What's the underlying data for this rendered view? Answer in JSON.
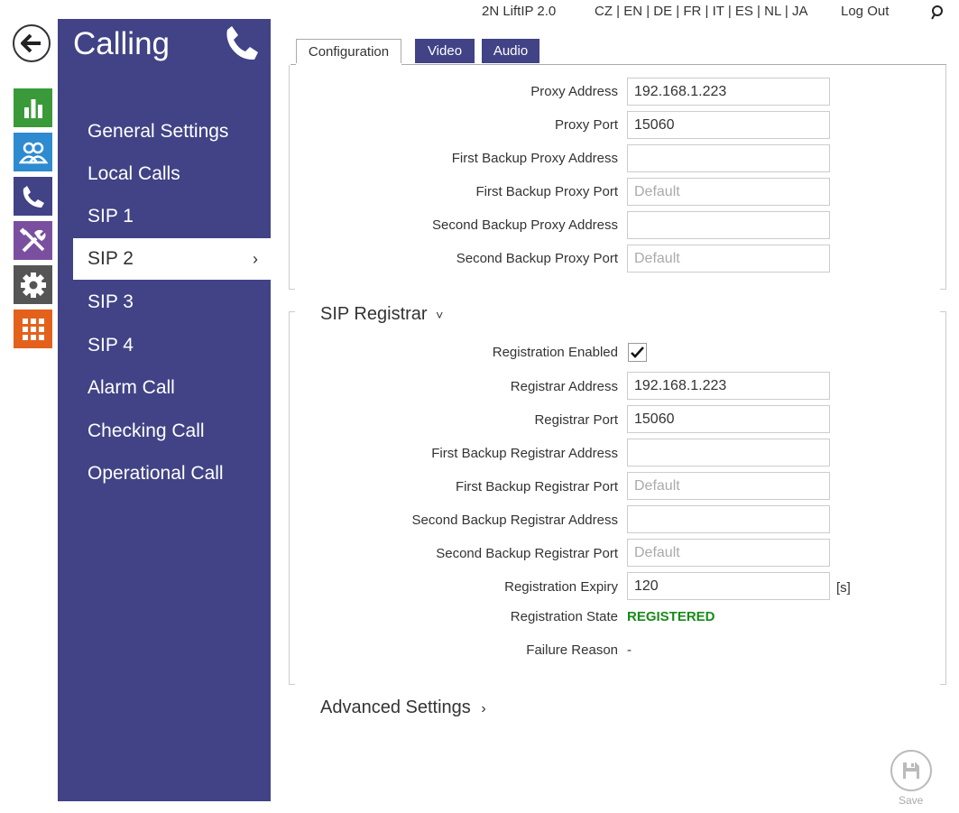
{
  "colors": {
    "sidebar": "#414386",
    "status_green": "#3a9a3a",
    "users_blue": "#2e8bd0",
    "calling_navy": "#414386",
    "services_purple": "#7b4fa0",
    "system_gray": "#555555",
    "apps_orange": "#e4611c",
    "registered_green": "#1a8a1a"
  },
  "rail": [
    {
      "name": "status-icon"
    },
    {
      "name": "directory-icon"
    },
    {
      "name": "phone-icon"
    },
    {
      "name": "tools-icon"
    },
    {
      "name": "gear-icon"
    },
    {
      "name": "grid-icon"
    }
  ],
  "sidebar": {
    "title": "Calling",
    "items": [
      {
        "label": "General Settings"
      },
      {
        "label": "Local Calls"
      },
      {
        "label": "SIP 1"
      },
      {
        "label": "SIP 2",
        "active": true
      },
      {
        "label": "SIP 3"
      },
      {
        "label": "SIP 4"
      },
      {
        "label": "Alarm Call"
      },
      {
        "label": "Checking Call"
      },
      {
        "label": "Operational Call"
      }
    ]
  },
  "topbar": {
    "product": "2N LiftIP 2.0",
    "languages": "CZ | EN | DE | FR | IT | ES | NL | JA",
    "logout": "Log Out"
  },
  "tabs": [
    {
      "label": "Configuration",
      "active": true
    },
    {
      "label": "Video"
    },
    {
      "label": "Audio"
    }
  ],
  "proxy": {
    "proxy_address": {
      "label": "Proxy Address",
      "value": "192.168.1.223"
    },
    "proxy_port": {
      "label": "Proxy Port",
      "value": "15060"
    },
    "first_backup_address": {
      "label": "First Backup Proxy Address",
      "value": ""
    },
    "first_backup_port": {
      "label": "First Backup Proxy Port",
      "placeholder": "Default"
    },
    "second_backup_address": {
      "label": "Second Backup Proxy Address",
      "value": ""
    },
    "second_backup_port": {
      "label": "Second Backup Proxy Port",
      "placeholder": "Default"
    }
  },
  "registrar": {
    "heading": "SIP Registrar",
    "enabled_label": "Registration Enabled",
    "enabled": true,
    "address": {
      "label": "Registrar Address",
      "value": "192.168.1.223"
    },
    "port": {
      "label": "Registrar Port",
      "value": "15060"
    },
    "first_backup_address": {
      "label": "First Backup Registrar Address",
      "value": ""
    },
    "first_backup_port": {
      "label": "First Backup Registrar Port",
      "placeholder": "Default"
    },
    "second_backup_address": {
      "label": "Second Backup Registrar Address",
      "value": ""
    },
    "second_backup_port": {
      "label": "Second Backup Registrar Port",
      "placeholder": "Default"
    },
    "expiry": {
      "label": "Registration Expiry",
      "value": "120",
      "unit": "[s]"
    },
    "state_label": "Registration State",
    "state_value": "REGISTERED",
    "failure_label": "Failure Reason",
    "failure_value": "-"
  },
  "advanced": {
    "heading": "Advanced Settings"
  },
  "save": {
    "label": "Save"
  }
}
